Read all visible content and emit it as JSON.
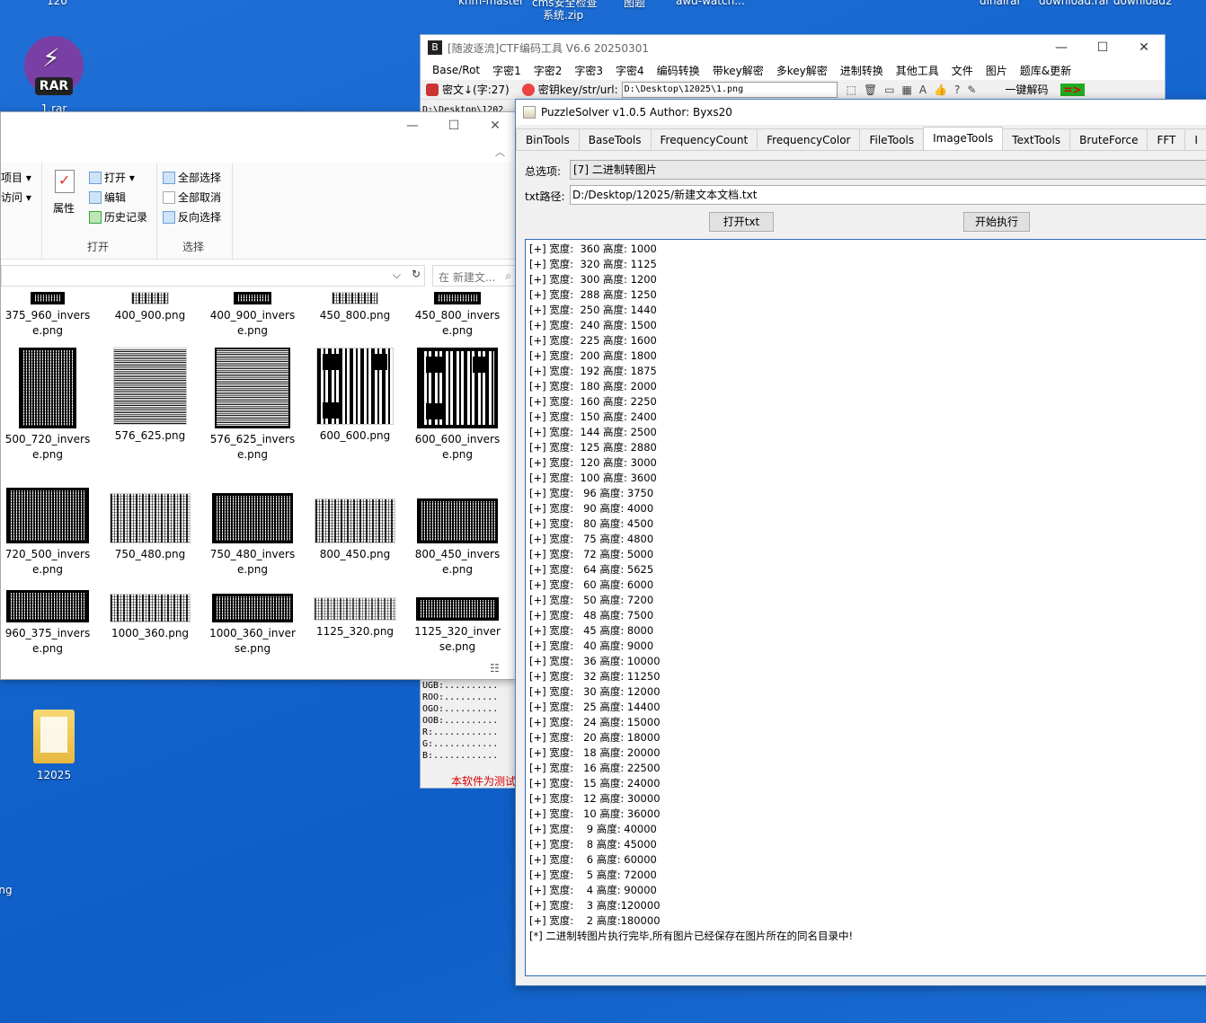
{
  "desktop": {
    "top_labels": [
      "120",
      "knm-master",
      "cms安全检查",
      "图题",
      "awd-watch...",
      "dinalrar",
      "download.rar  download2"
    ],
    "icons": [
      {
        "label": "1.rar"
      },
      {
        "label": "12025"
      },
      {
        "label": "ng"
      }
    ],
    "zip_label": "系统.zip"
  },
  "ctf_tool": {
    "title": "[随波逐流]CTF编码工具 V6.6 20250301",
    "menu": [
      "Base/Rot",
      "字密1",
      "字密2",
      "字密3",
      "字密4",
      "编码转换",
      "带key解密",
      "多key解密",
      "进制转换",
      "其他工具",
      "文件",
      "图片",
      "题库&更新"
    ],
    "cipher_label": "密文↓(字:27)",
    "key_label": "密钥key/str/url:",
    "key_value": "D:\\Desktop\\12025\\1.png",
    "decode_button": "一键解码",
    "path_fragment": "D:\\Desktop\\1202",
    "mono_lines": [
      "UGB:..........",
      "ROO:..........",
      "OGO:..........",
      "OOB:..........",
      "R:............",
      "G:............",
      "B:............"
    ],
    "red_notice": "本软件为测试"
  },
  "explorer": {
    "ribbon": {
      "left_items": [
        "项目 ▾",
        "访问 ▾"
      ],
      "open_group": {
        "properties": "属性",
        "open": "打开 ▾",
        "edit": "编辑",
        "history": "历史记录",
        "caption": "打开"
      },
      "select_group": {
        "select_all": "全部选择",
        "select_none": "全部取消",
        "invert": "反向选择",
        "caption": "选择"
      }
    },
    "search_placeholder": "在 新建文...",
    "files": [
      {
        "name": "375_960_invers\ne.png"
      },
      {
        "name": "400_900.png"
      },
      {
        "name": "400_900_invers\ne.png"
      },
      {
        "name": "450_800.png"
      },
      {
        "name": "450_800_invers\ne.png"
      },
      {
        "name": "500_720_invers\ne.png"
      },
      {
        "name": "576_625.png"
      },
      {
        "name": "576_625_invers\ne.png"
      },
      {
        "name": "600_600.png"
      },
      {
        "name": "600_600_invers\ne.png"
      },
      {
        "name": "720_500_invers\ne.png"
      },
      {
        "name": "750_480.png"
      },
      {
        "name": "750_480_invers\ne.png"
      },
      {
        "name": "800_450.png"
      },
      {
        "name": "800_450_invers\ne.png"
      },
      {
        "name": "960_375_invers\ne.png"
      },
      {
        "name": "1000_360.png"
      },
      {
        "name": "1000_360_inver\nse.png"
      },
      {
        "name": "1125_320.png"
      },
      {
        "name": "1125_320_inver\nse.png"
      }
    ]
  },
  "puzzle": {
    "title": "PuzzleSolver v1.0.5  Author:  Byxs20",
    "tabs": [
      "BinTools",
      "BaseTools",
      "FrequencyCount",
      "FrequencyColor",
      "FileTools",
      "ImageTools",
      "TextTools",
      "BruteForce",
      "FFT",
      "I"
    ],
    "active_tab": "ImageTools",
    "option_label": "总选项:",
    "option_value": "[7] 二进制转图片",
    "txt_label": "txt路径:",
    "txt_value": "D:/Desktop/12025/新建文本文档.txt",
    "open_button": "打开txt",
    "run_button": "开始执行",
    "output_lines": [
      "[+] 宽度:  360 高度: 1000",
      "[+] 宽度:  320 高度: 1125",
      "[+] 宽度:  300 高度: 1200",
      "[+] 宽度:  288 高度: 1250",
      "[+] 宽度:  250 高度: 1440",
      "[+] 宽度:  240 高度: 1500",
      "[+] 宽度:  225 高度: 1600",
      "[+] 宽度:  200 高度: 1800",
      "[+] 宽度:  192 高度: 1875",
      "[+] 宽度:  180 高度: 2000",
      "[+] 宽度:  160 高度: 2250",
      "[+] 宽度:  150 高度: 2400",
      "[+] 宽度:  144 高度: 2500",
      "[+] 宽度:  125 高度: 2880",
      "[+] 宽度:  120 高度: 3000",
      "[+] 宽度:  100 高度: 3600",
      "[+] 宽度:   96 高度: 3750",
      "[+] 宽度:   90 高度: 4000",
      "[+] 宽度:   80 高度: 4500",
      "[+] 宽度:   75 高度: 4800",
      "[+] 宽度:   72 高度: 5000",
      "[+] 宽度:   64 高度: 5625",
      "[+] 宽度:   60 高度: 6000",
      "[+] 宽度:   50 高度: 7200",
      "[+] 宽度:   48 高度: 7500",
      "[+] 宽度:   45 高度: 8000",
      "[+] 宽度:   40 高度: 9000",
      "[+] 宽度:   36 高度: 10000",
      "[+] 宽度:   32 高度: 11250",
      "[+] 宽度:   30 高度: 12000",
      "[+] 宽度:   25 高度: 14400",
      "[+] 宽度:   24 高度: 15000",
      "[+] 宽度:   20 高度: 18000",
      "[+] 宽度:   18 高度: 20000",
      "[+] 宽度:   16 高度: 22500",
      "[+] 宽度:   15 高度: 24000",
      "[+] 宽度:   12 高度: 30000",
      "[+] 宽度:   10 高度: 36000",
      "[+] 宽度:    9 高度: 40000",
      "[+] 宽度:    8 高度: 45000",
      "[+] 宽度:    6 高度: 60000",
      "[+] 宽度:    5 高度: 72000",
      "[+] 宽度:    4 高度: 90000",
      "[+] 宽度:    3 高度:120000",
      "[+] 宽度:    2 高度:180000",
      "[*] 二进制转图片执行完毕,所有图片已经保存在图片所在的同名目录中!"
    ]
  },
  "colors": {
    "desktop_blue": "#1565cf",
    "output_border": "#2d6db5",
    "notice_red": "#dd0000"
  }
}
